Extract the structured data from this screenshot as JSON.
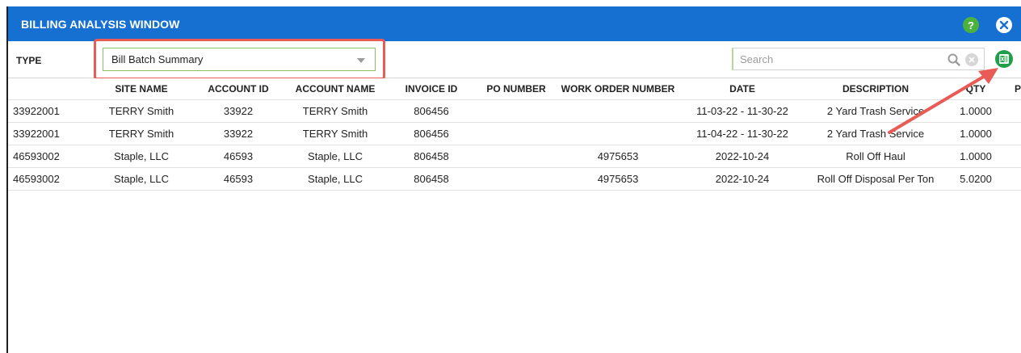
{
  "window": {
    "title": "BILLING ANALYSIS WINDOW",
    "help_label": "?",
    "help_icon": "question-icon",
    "close_icon": "close-icon"
  },
  "toolbar": {
    "type_label": "TYPE",
    "type_value": "Bill Batch Summary",
    "search_placeholder": "Search",
    "search_value": "",
    "export_icon": "excel-export-icon"
  },
  "colors": {
    "title_bar": "#1670d2",
    "highlight": "#e95b55",
    "help": "#4db23d",
    "excel": "#1f9f4a"
  },
  "table": {
    "columns": [
      "",
      "SITE NAME",
      "ACCOUNT ID",
      "ACCOUNT NAME",
      "INVOICE ID",
      "PO NUMBER",
      "WORK ORDER NUMBER",
      "DATE",
      "DESCRIPTION",
      "QTY",
      "P"
    ],
    "rows": [
      [
        "33922001",
        "TERRY Smith",
        "33922",
        "TERRY Smith",
        "806456",
        "",
        "",
        "11-03-22 - 11-30-22",
        "2 Yard Trash Service",
        "1.0000",
        ""
      ],
      [
        "33922001",
        "TERRY Smith",
        "33922",
        "TERRY Smith",
        "806456",
        "",
        "",
        "11-04-22 - 11-30-22",
        "2 Yard Trash Service",
        "1.0000",
        ""
      ],
      [
        "46593002",
        "Staple, LLC",
        "46593",
        "Staple, LLC",
        "806458",
        "",
        "4975653",
        "2022-10-24",
        "Roll Off Haul",
        "1.0000",
        ""
      ],
      [
        "46593002",
        "Staple, LLC",
        "46593",
        "Staple, LLC",
        "806458",
        "",
        "4975653",
        "2022-10-24",
        "Roll Off Disposal Per Ton",
        "5.0200",
        ""
      ]
    ]
  }
}
